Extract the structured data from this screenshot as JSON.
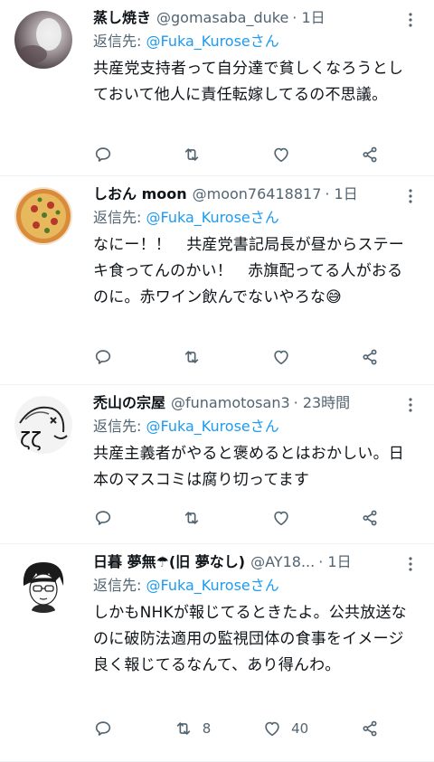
{
  "tweets": [
    {
      "name": "蒸し焼き",
      "handle": "@gomasaba_duke",
      "time": "· 1日",
      "reply_prefix": "返信先: ",
      "reply_to": "@Fuka_Kuroseさん",
      "text": "共産党支持者って自分達で貧しくなろうとしておいて他人に責任転嫁してるの不思議。",
      "retweets": "",
      "likes": ""
    },
    {
      "name": "しおん moon",
      "handle": "@moon76418817",
      "time": "· 1日",
      "reply_prefix": "返信先: ",
      "reply_to": "@Fuka_Kuroseさん",
      "text": "なにー！！　共産党書記局長が昼からステーキ食ってんのかい！　赤旗配ってる人がおるのに。赤ワイン飲んでないやろな😅",
      "retweets": "",
      "likes": ""
    },
    {
      "name": "禿山の宗屋",
      "handle": "@funamotosan3",
      "time": "· 23時間",
      "reply_prefix": "返信先: ",
      "reply_to": "@Fuka_Kuroseさん",
      "text": "共産主義者がやると褒めるとはおかしい。日本のマスコミは腐り切ってます",
      "retweets": "",
      "likes": ""
    },
    {
      "name": "日暮 夢無☂(旧 夢なし)",
      "handle": "@AY18...",
      "time": "· 1日",
      "reply_prefix": "返信先: ",
      "reply_to": "@Fuka_Kuroseさん",
      "text": "しかもNHKが報じてるときたよ。公共放送なのに破防法適用の監視団体の食事をイメージ良く報じてるなんて、あり得んわ。",
      "retweets": "8",
      "likes": "40"
    }
  ],
  "icons": {
    "reply": "reply-icon",
    "retweet": "retweet-icon",
    "like": "heart-icon",
    "share": "share-icon",
    "more": "more-icon"
  },
  "colors": {
    "link": "#1d9bf0",
    "secondary": "#536471",
    "divider": "#eff3f4"
  }
}
